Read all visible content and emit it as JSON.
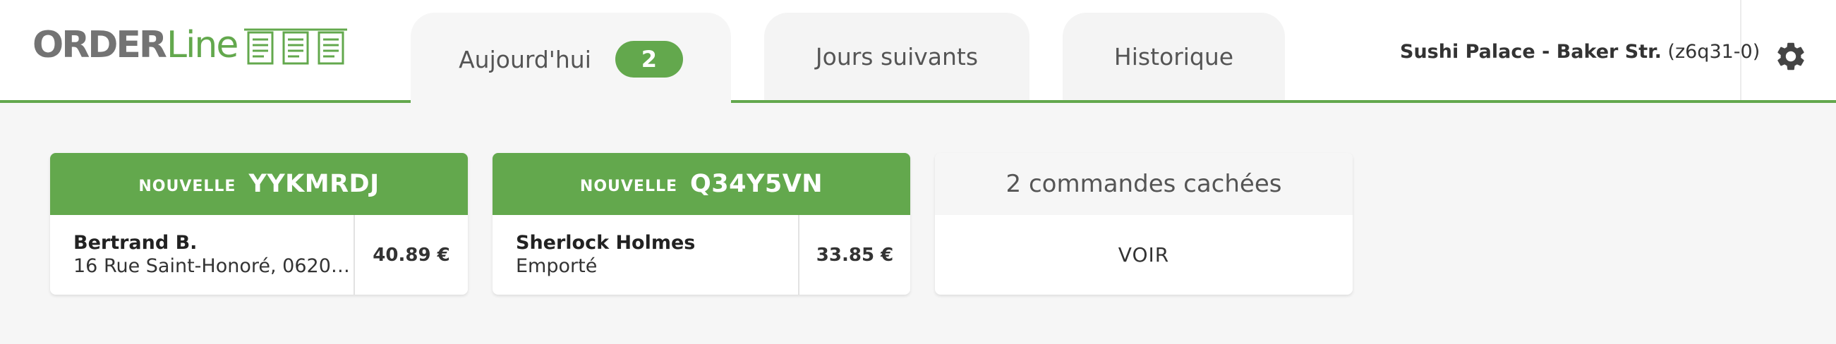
{
  "header": {
    "logo": {
      "part1": "ORDER",
      "part2": "Line"
    },
    "tabs": [
      {
        "label": "Aujourd'hui",
        "badge": "2"
      },
      {
        "label": "Jours suivants"
      },
      {
        "label": "Historique"
      }
    ],
    "store": {
      "name": "Sushi Palace - Baker Str.",
      "code": "(z6q31-0)"
    },
    "settings_icon": "gear-icon"
  },
  "orders": [
    {
      "status": "NOUVELLE",
      "code": "YYKMRDJ",
      "customer": "Bertrand B.",
      "detail": "16 Rue Saint-Honoré, 06200 …",
      "price": "40.89 €"
    },
    {
      "status": "NOUVELLE",
      "code": "Q34Y5VN",
      "customer": "Sherlock Holmes",
      "detail": "Emporté",
      "price": "33.85 €"
    }
  ],
  "hidden_orders": {
    "title": "2 commandes cachées",
    "action": "VOIR"
  },
  "colors": {
    "accent": "#63a84d",
    "logo_gray": "#737373",
    "background": "#f6f6f6"
  }
}
